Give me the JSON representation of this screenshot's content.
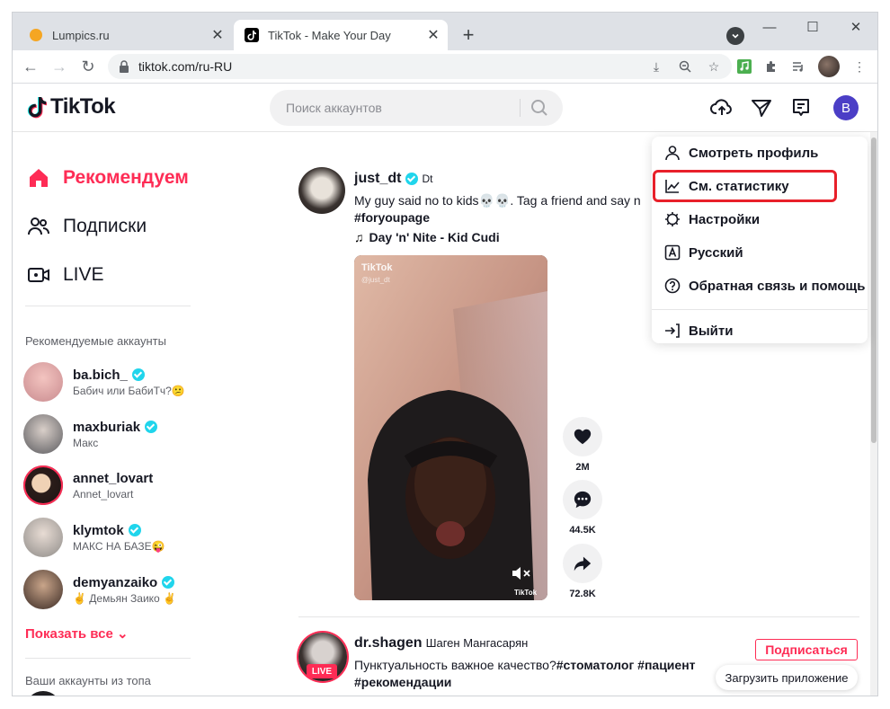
{
  "browser": {
    "tabs": [
      {
        "title": "Lumpics.ru",
        "active": false
      },
      {
        "title": "TikTok - Make Your Day",
        "active": true
      }
    ],
    "new_tab_symbol": "+",
    "url": "tiktok.com/ru-RU"
  },
  "header": {
    "logo_text": "TikTok",
    "search_placeholder": "Поиск аккаунтов",
    "avatar_letter": "B"
  },
  "sidebar": {
    "nav": [
      {
        "label": "Рекомендуем",
        "active": true,
        "icon": "home-icon"
      },
      {
        "label": "Подписки",
        "active": false,
        "icon": "people-icon"
      },
      {
        "label": "LIVE",
        "active": false,
        "icon": "live-icon"
      }
    ],
    "suggested_title": "Рекомендуемые аккаунты",
    "accounts": [
      {
        "username": "ba.bich_",
        "subtitle": "Бабич или БабиТч?😕",
        "verified": true
      },
      {
        "username": "maxburiak",
        "subtitle": "Макс",
        "verified": true
      },
      {
        "username": "annet_lovart",
        "subtitle": "Annet_lovart",
        "verified": false
      },
      {
        "username": "klymtok",
        "subtitle": "МАКС НА БАЗЕ😜",
        "verified": true
      },
      {
        "username": "demyanzaiko",
        "subtitle": "✌ Демьян Заико ✌",
        "verified": true
      }
    ],
    "show_all": "Показать все",
    "top_accounts_title": "Ваши аккаунты из топа"
  },
  "feed": {
    "post1": {
      "username": "just_dt",
      "nickname": "Dt",
      "caption": "My guy said no to kids💀💀. Tag a friend and say n",
      "hashtag": "#foryoupage",
      "music": "Day 'n' Nite - Kid Cudi",
      "video_watermark": "TikTok",
      "video_watermark_user": "@just_dt",
      "likes": "2M",
      "comments": "44.5K",
      "shares": "72.8K"
    },
    "post2": {
      "username": "dr.shagen",
      "nickname": "Шаген Мангасарян",
      "caption": "Пунктуальность важное качество?",
      "hashtags_inline": "#стоматолог #пациент",
      "hashtags_next": "#рекомендации",
      "live_badge": "LIVE",
      "follow_label": "Подписаться"
    },
    "download_app": "Загрузить приложение"
  },
  "dropdown": {
    "items": [
      {
        "label": "Смотреть профиль",
        "icon": "user-icon"
      },
      {
        "label": "См. статистику",
        "icon": "chart-icon"
      },
      {
        "label": "Настройки",
        "icon": "gear-icon"
      },
      {
        "label": "Русский",
        "icon": "language-icon"
      },
      {
        "label": "Обратная связь и помощь",
        "icon": "help-icon"
      },
      {
        "label": "Выйти",
        "icon": "logout-icon"
      }
    ]
  },
  "colors": {
    "accent": "#fe2c55",
    "highlight": "#e8202a",
    "avatar": "#4b3ec6",
    "verified": "#20d5ec"
  }
}
